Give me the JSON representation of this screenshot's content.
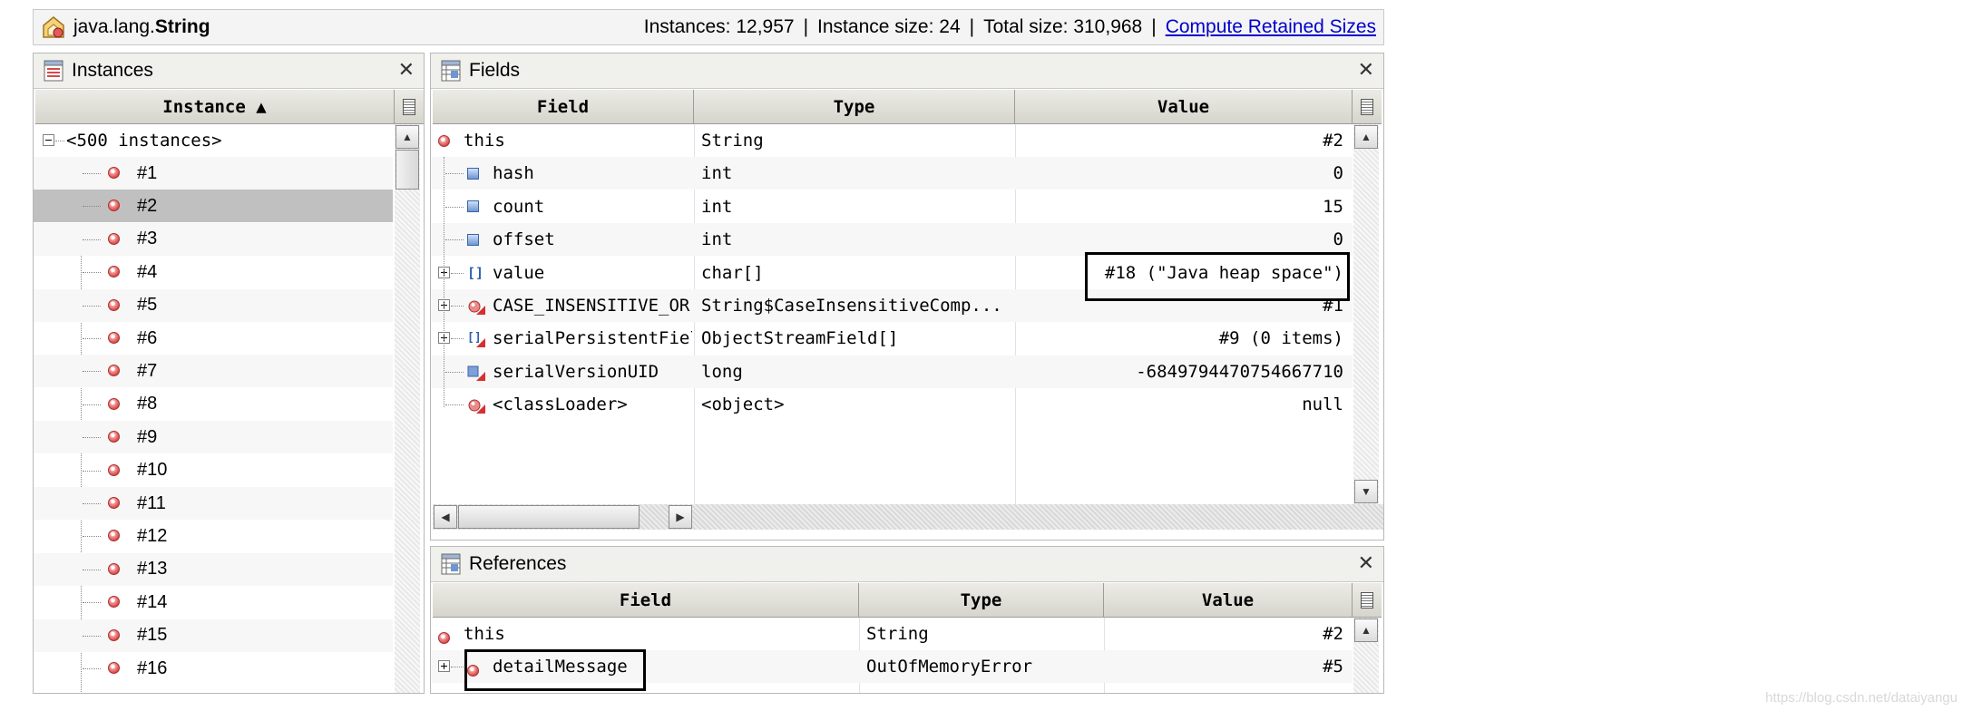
{
  "class_bar": {
    "package": "java.lang.",
    "class_name": "String",
    "instances_text": "Instances: 12,957",
    "instance_size_text": "Instance size: 24",
    "total_size_text": "Total size: 310,968",
    "sep": "|",
    "compute_link": "Compute Retained Sizes"
  },
  "instances_panel": {
    "title": "Instances",
    "column_header": "Instance ▲",
    "root_label": "<500 instances>",
    "items": [
      "#1",
      "#2",
      "#3",
      "#4",
      "#5",
      "#6",
      "#7",
      "#8",
      "#9",
      "#10",
      "#11",
      "#12",
      "#13",
      "#14",
      "#15",
      "#16"
    ],
    "selected_item": "#2"
  },
  "fields_panel": {
    "title": "Fields",
    "columns": {
      "field": "Field",
      "type": "Type",
      "value": "Value"
    },
    "rows": [
      {
        "field": "this",
        "type": "String",
        "value": "#2",
        "icon": "instance-dot"
      },
      {
        "field": "hash",
        "type": "int",
        "value": "0",
        "icon": "primitive-square"
      },
      {
        "field": "count",
        "type": "int",
        "value": "15",
        "icon": "primitive-square"
      },
      {
        "field": "offset",
        "type": "int",
        "value": "0",
        "icon": "primitive-square"
      },
      {
        "field": "value",
        "type": "char[]",
        "value": "#18 (\"Java heap space\")",
        "icon": "array-icon"
      },
      {
        "field": "CASE_INSENSITIVE_OR",
        "type": "String$CaseInsensitiveComp...",
        "value": "#1",
        "icon": "static-instance-icon"
      },
      {
        "field": "serialPersistentFields",
        "type": "ObjectStreamField[]",
        "value": "#9 (0 items)",
        "icon": "static-array-icon"
      },
      {
        "field": "serialVersionUID",
        "type": "long",
        "value": "-6849794470754667710",
        "icon": "static-primitive-icon"
      },
      {
        "field": "<classLoader>",
        "type": "<object>",
        "value": "null",
        "icon": "static-instance-icon"
      }
    ]
  },
  "references_panel": {
    "title": "References",
    "columns": {
      "field": "Field",
      "type": "Type",
      "value": "Value"
    },
    "rows": [
      {
        "field": "this",
        "type": "String",
        "value": "#2"
      },
      {
        "field": "detailMessage",
        "type": "OutOfMemoryError",
        "value": "#5"
      }
    ]
  },
  "watermark": "https://blog.csdn.net/dataiyangu",
  "colors": {
    "selected_row": "#c0c0c0",
    "link": "#0000cc",
    "header_bg": "#d6d5cc"
  }
}
